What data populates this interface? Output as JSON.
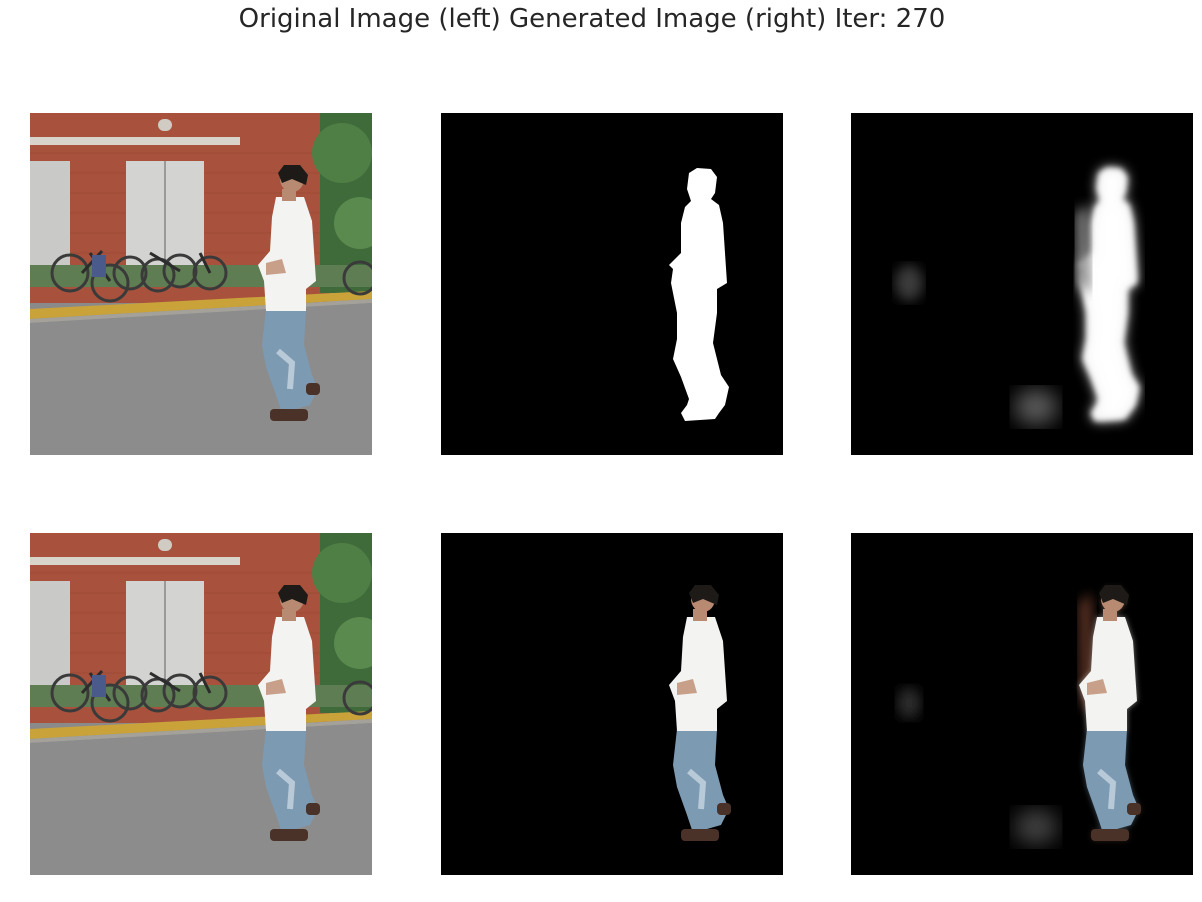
{
  "figure": {
    "title": "Original Image (left) Generated Image (right) Iter: 270"
  },
  "colors": {
    "background": "#ffffff",
    "title_text": "#262626",
    "mask_background": "#000000",
    "mask_foreground": "#ffffff"
  },
  "grid": {
    "rows": 2,
    "cols": 3
  }
}
